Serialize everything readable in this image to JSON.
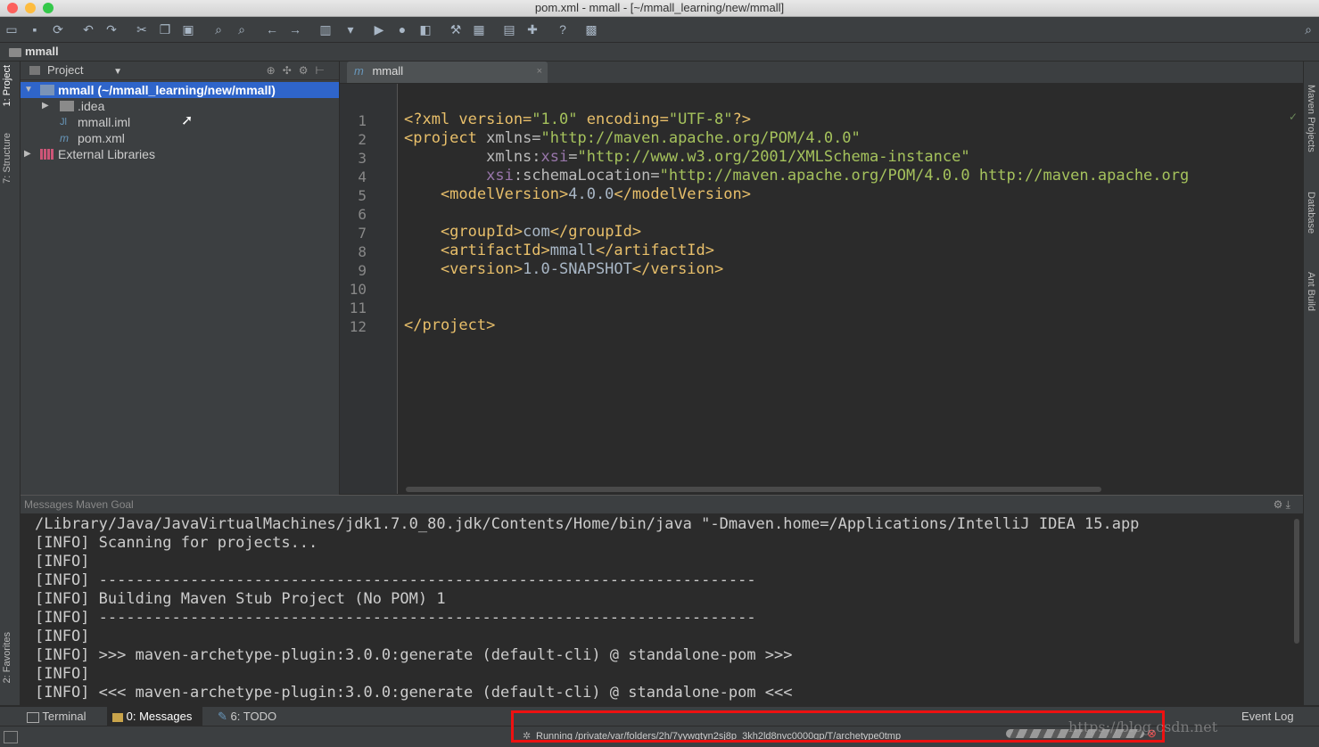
{
  "window": {
    "title": "pom.xml - mmall - [~/mmall_learning/new/mmall]"
  },
  "navbar": {
    "project_label": "mmall"
  },
  "left_strip": {
    "tabs": [
      "1: Project",
      "7: Structure",
      "2: Favorites"
    ]
  },
  "right_strip": {
    "tabs": [
      "Maven Projects",
      "Database",
      "Ant Build"
    ]
  },
  "project_panel": {
    "title": "Project",
    "tree": [
      {
        "label": "mmall (~/mmall_learning/new/mmall)",
        "icon": "module-folder-icon",
        "selected": true,
        "expanded": true
      },
      {
        "label": ".idea",
        "icon": "folder-icon",
        "collapsed": true
      },
      {
        "label": "mmall.iml",
        "icon": "iml-file-icon"
      },
      {
        "label": "pom.xml",
        "icon": "maven-file-icon"
      },
      {
        "label": "External Libraries",
        "icon": "libraries-icon",
        "collapsed": true
      }
    ]
  },
  "editor": {
    "tab_label": "mmall",
    "line_numbers": [
      "1",
      "2",
      "3",
      "4",
      "5",
      "6",
      "7",
      "8",
      "9",
      "10",
      "11",
      "12"
    ],
    "lines": [
      [
        {
          "t": "<?xml version=",
          "c": "tag"
        },
        {
          "t": "\"1.0\"",
          "c": "str"
        },
        {
          "t": " encoding=",
          "c": "tag"
        },
        {
          "t": "\"UTF-8\"",
          "c": "str"
        },
        {
          "t": "?>",
          "c": "tag"
        }
      ],
      [
        {
          "t": "<project ",
          "c": "tag"
        },
        {
          "t": "xmlns=",
          "c": "attr"
        },
        {
          "t": "\"http://maven.apache.org/POM/4.0.0\"",
          "c": "str"
        }
      ],
      [
        {
          "t": "         xmlns:",
          "c": "attr"
        },
        {
          "t": "xsi",
          "c": "ns"
        },
        {
          "t": "=",
          "c": "attr"
        },
        {
          "t": "\"http://www.w3.org/2001/XMLSchema-instance\"",
          "c": "str"
        }
      ],
      [
        {
          "t": "         ",
          "c": "attr"
        },
        {
          "t": "xsi",
          "c": "ns"
        },
        {
          "t": ":schemaLocation=",
          "c": "attr"
        },
        {
          "t": "\"http://maven.apache.org/POM/4.0.0 http://maven.apache.org",
          "c": "str"
        }
      ],
      [
        {
          "t": "    <modelVersion>",
          "c": "tag"
        },
        {
          "t": "4.0.0",
          "c": "text"
        },
        {
          "t": "</modelVersion>",
          "c": "tag"
        }
      ],
      [],
      [
        {
          "t": "    <groupId>",
          "c": "tag"
        },
        {
          "t": "com",
          "c": "text"
        },
        {
          "t": "</groupId>",
          "c": "tag"
        }
      ],
      [
        {
          "t": "    <artifactId>",
          "c": "tag"
        },
        {
          "t": "mmall",
          "c": "text"
        },
        {
          "t": "</artifactId>",
          "c": "tag"
        }
      ],
      [
        {
          "t": "    <version>",
          "c": "tag"
        },
        {
          "t": "1.0-SNAPSHOT",
          "c": "text"
        },
        {
          "t": "</version>",
          "c": "tag"
        }
      ],
      [],
      [],
      [
        {
          "t": "</project>",
          "c": "tag"
        }
      ]
    ]
  },
  "messages": {
    "header": "Messages Maven Goal",
    "lines": [
      "/Library/Java/JavaVirtualMachines/jdk1.7.0_80.jdk/Contents/Home/bin/java \"-Dmaven.home=/Applications/IntelliJ IDEA 15.app",
      "[INFO] Scanning for projects...",
      "[INFO]",
      "[INFO] ------------------------------------------------------------------------",
      "[INFO] Building Maven Stub Project (No POM) 1",
      "[INFO] ------------------------------------------------------------------------",
      "[INFO]",
      "[INFO] >>> maven-archetype-plugin:3.0.0:generate (default-cli) @ standalone-pom >>>",
      "[INFO]",
      "[INFO] <<< maven-archetype-plugin:3.0.0:generate (default-cli) @ standalone-pom <<<"
    ]
  },
  "bottom_tabs": {
    "terminal": "Terminal",
    "messages": "0: Messages",
    "todo": "6: TODO",
    "event_log": "Event Log"
  },
  "status_bar": {
    "running_text": "Running /private/var/folders/2h/7yywgtyn2sj8p_3kh2ld8nvc0000gp/T/archetype0tmp"
  },
  "watermark": "https://blog.csdn.net",
  "colors": {
    "tag": "#e8bf6a",
    "attr": "#bababa",
    "ns": "#9876aa",
    "str": "#a5c25c",
    "text": "#a9b7c6",
    "selection": "#2f65ca",
    "highlight_box": "#ee1111"
  }
}
